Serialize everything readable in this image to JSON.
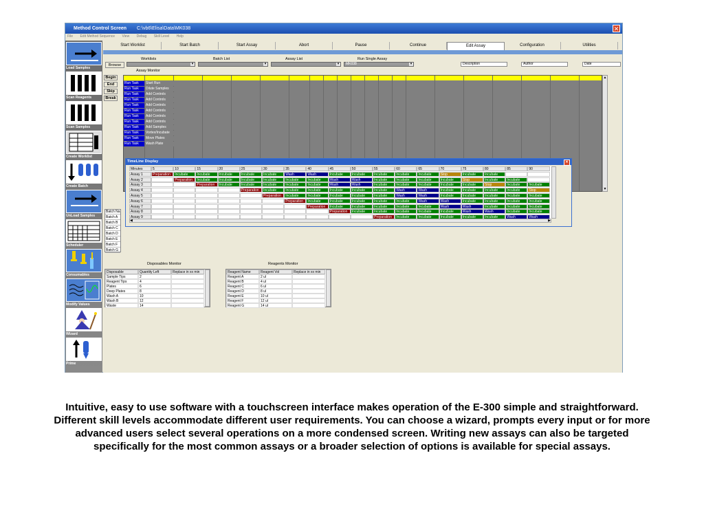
{
  "window": {
    "app_title": "Method Control Screen",
    "path": "C:\\vb6\\Elisa\\Data\\MK038",
    "menu": [
      "File",
      "Edit Method Sequence",
      "View",
      "Debug",
      "Skill Level",
      "Help"
    ]
  },
  "sidebar": [
    {
      "label": "Load Samples",
      "icon": "arrow-right-icon"
    },
    {
      "label": "Scan Reagents",
      "icon": "barcode-icon"
    },
    {
      "label": "Scan Samples",
      "icon": "barcode-icon"
    },
    {
      "label": "Create Worklist",
      "icon": "worklist-icon"
    },
    {
      "label": "Create Batch",
      "icon": "tubes-icon"
    },
    {
      "label": "UnLoad Samples",
      "icon": "arrow-right-icon"
    },
    {
      "label": "Scheduler",
      "icon": "calendar-icon"
    },
    {
      "label": "Consumables",
      "icon": "pipette-icon"
    },
    {
      "label": "Modify Values",
      "icon": "wave-icon"
    },
    {
      "label": "Wizard",
      "icon": "wizard-icon"
    },
    {
      "label": "Prime",
      "icon": "prime-icon"
    }
  ],
  "tabs": [
    "Start Worklist",
    "Start Batch",
    "Start Assay",
    "Abort",
    "Pause",
    "Continue",
    "Edit Assay",
    "Configuration",
    "Utilities"
  ],
  "active_tab": "Edit Assay",
  "selectors": {
    "browse": "Browse",
    "worklists_label": "Worklists",
    "batch_list_label": "Batch List",
    "assay_list_label": "Assay List",
    "run_single_label": "Run Single Assay",
    "run_single_value": "MK038",
    "description": "Description",
    "author": "Author",
    "date": "Date"
  },
  "assay_monitor": {
    "title": "Assay Monitor",
    "buttons": [
      "Begin",
      "End",
      "Skip",
      "Break"
    ],
    "rows": [
      [
        "Run Task",
        "Start Run"
      ],
      [
        "Run Task",
        "Dilute Samples"
      ],
      [
        "Run Task",
        "Add Controls"
      ],
      [
        "Run Task",
        "Add Controls"
      ],
      [
        "Run Task",
        "Add Controls"
      ],
      [
        "Run Task",
        "Add Controls"
      ],
      [
        "Run Task",
        "Add Controls"
      ],
      [
        "Run Task",
        "Add Controls"
      ],
      [
        "Run Task",
        "Add Samples"
      ],
      [
        "Run Task",
        "Vortex/Incubate"
      ],
      [
        "Run Task",
        "Move Plates"
      ],
      [
        "Run Task",
        "Wash Plate"
      ]
    ]
  },
  "batches": [
    "Batch Na",
    "Batch A",
    "Batch B",
    "Batch C",
    "Batch D",
    "Batch E",
    "Batch F",
    "Batch G"
  ],
  "timeline": {
    "title": "TimeLine Display",
    "header": [
      "Minutes",
      "5",
      "10",
      "15",
      "20",
      "25",
      "30",
      "35",
      "40",
      "45",
      "50",
      "55",
      "60",
      "65",
      "70",
      "75",
      "80",
      "85",
      "90"
    ],
    "rows": [
      {
        "name": "Assay 1",
        "cells": [
          "Preparation",
          "Incubate",
          "Incubate",
          "Incubate",
          "Incubate",
          "Incubate",
          "Wash",
          "Wash",
          "Incubate",
          "Incubate",
          "Incubate",
          "Incubate",
          "Incubate",
          "Stop",
          "Incubate",
          "Incubate",
          "",
          ""
        ]
      },
      {
        "name": "Assay 2",
        "cells": [
          "",
          "Preparation",
          "Incubate",
          "Incubate",
          "Incubate",
          "Incubate",
          "Incubate",
          "Incubate",
          "Wash",
          "Wash",
          "Incubate",
          "Incubate",
          "Incubate",
          "Incubate",
          "Stop",
          "Incubate",
          "Incubate",
          ""
        ]
      },
      {
        "name": "Assay 3",
        "cells": [
          "",
          "",
          "Preparation",
          "Incubate",
          "Incubate",
          "Incubate",
          "Incubate",
          "Incubate",
          "Wash",
          "Wash",
          "Incubate",
          "Incubate",
          "Incubate",
          "Incubate",
          "Incubate",
          "Stop",
          "Incubate",
          "Incubate"
        ]
      },
      {
        "name": "Assay 4",
        "cells": [
          "",
          "",
          "",
          "",
          "Preparation",
          "Incubate",
          "Incubate",
          "Incubate",
          "Incubate",
          "Incubate",
          "Incubate",
          "Wash",
          "Wash",
          "Incubate",
          "Incubate",
          "Incubate",
          "Incubate",
          "Stop"
        ]
      },
      {
        "name": "Assay 5",
        "cells": [
          "",
          "",
          "",
          "",
          "",
          "Preparation",
          "Incubate",
          "Incubate",
          "Incubate",
          "Incubate",
          "Incubate",
          "Wash",
          "Wash",
          "Incubate",
          "Incubate",
          "Incubate",
          "Incubate",
          "Incubate"
        ]
      },
      {
        "name": "Assay 6",
        "cells": [
          "",
          "",
          "",
          "",
          "",
          "",
          "Preparation",
          "Incubate",
          "Incubate",
          "Incubate",
          "Incubate",
          "Incubate",
          "Wash",
          "Wash",
          "Incubate",
          "Incubate",
          "Incubate",
          "Incubate"
        ]
      },
      {
        "name": "Assay 7",
        "cells": [
          "",
          "",
          "",
          "",
          "",
          "",
          "",
          "Preparation",
          "Incubate",
          "Incubate",
          "Incubate",
          "Incubate",
          "Incubate",
          "Wash",
          "Wash",
          "Incubate",
          "Incubate",
          "Incubate"
        ]
      },
      {
        "name": "Assay 8",
        "cells": [
          "",
          "",
          "",
          "",
          "",
          "",
          "",
          "",
          "Preparation",
          "Incubate",
          "Incubate",
          "Incubate",
          "Incubate",
          "Incubate",
          "Wash",
          "Wash",
          "Incubate",
          "Incubate"
        ]
      },
      {
        "name": "Assay 9",
        "cells": [
          "",
          "",
          "",
          "",
          "",
          "",
          "",
          "",
          "",
          "",
          "Preparation",
          "Incubate",
          "Incubate",
          "Incubate",
          "Incubate",
          "Incubate",
          "Wash",
          "Wash"
        ]
      }
    ]
  },
  "disposables": {
    "title": "Disposables Monitor",
    "headers": [
      "Disposable",
      "Quantity Left",
      "Replace in xx min"
    ],
    "rows": [
      [
        "Sample Tips",
        "2",
        ""
      ],
      [
        "Reagent Tips",
        "4",
        ""
      ],
      [
        "Plates",
        "6",
        ""
      ],
      [
        "Deep Plates",
        "8",
        ""
      ],
      [
        "Wash A",
        "10",
        ""
      ],
      [
        "Wash B",
        "12",
        ""
      ],
      [
        "Waste",
        "14",
        ""
      ]
    ]
  },
  "reagents": {
    "title": "Reagents Monitor",
    "headers": [
      "Reagent Name",
      "Reagent Vol",
      "Replace in xx min"
    ],
    "rows": [
      [
        "Reagent A",
        "2 ul",
        ""
      ],
      [
        "Reagent B",
        "4 ul",
        ""
      ],
      [
        "Reagent C",
        "6 ul",
        ""
      ],
      [
        "Reagent D",
        "8 ul",
        ""
      ],
      [
        "Reagent E",
        "10 ul",
        ""
      ],
      [
        "Reagent F",
        "12 ul",
        ""
      ],
      [
        "Reagent G",
        "14 ul",
        ""
      ]
    ]
  },
  "colors": {
    "Preparation": "#8b0000",
    "Incubate": "#008000",
    "Wash": "#00008b",
    "Stop": "#b8860b",
    "Run Task": "#0000cc"
  },
  "caption": "Intuitive, easy to use software with a touchscreen interface makes operation of the E-300 simple and straightforward. Different skill levels accommodate different user requirements. You can choose a wizard, prompts every input or for more advanced users select several operations on a more condensed screen. Writing new assays can also be targeted specifically for the most common assays or a broader selection of options is available for special assays."
}
